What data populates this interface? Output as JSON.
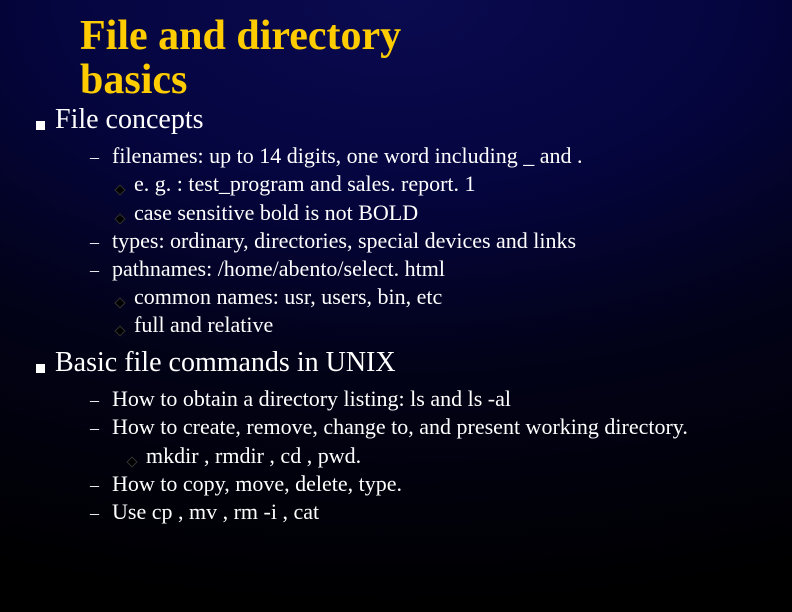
{
  "title_line1": "File and directory",
  "title_line2": "basics",
  "section1": {
    "heading": "File concepts",
    "items": [
      {
        "text": "filenames: up to 14 digits, one word including _ and .",
        "sub": [
          "e. g. : test_program  and  sales. report. 1",
          "case sensitive  bold is not BOLD"
        ]
      },
      {
        "text": "types: ordinary, directories, special devices and links",
        "sub": []
      },
      {
        "text": "pathnames: /home/abento/select. html",
        "sub": [
          "common names: usr, users, bin, etc",
          "full and relative"
        ]
      }
    ]
  },
  "section2": {
    "heading": "Basic file commands in UNIX",
    "items": [
      {
        "text": "How to obtain a directory listing: ls and ls -al",
        "sub": []
      },
      {
        "text": "How to create, remove, change to, and present working directory.",
        "sub": [
          "mkdir ,  rmdir , cd , pwd."
        ]
      },
      {
        "text": " How to copy, move, delete, type.",
        "sub": []
      },
      {
        "text": "Use cp , mv , rm -i , cat",
        "sub": []
      }
    ]
  }
}
